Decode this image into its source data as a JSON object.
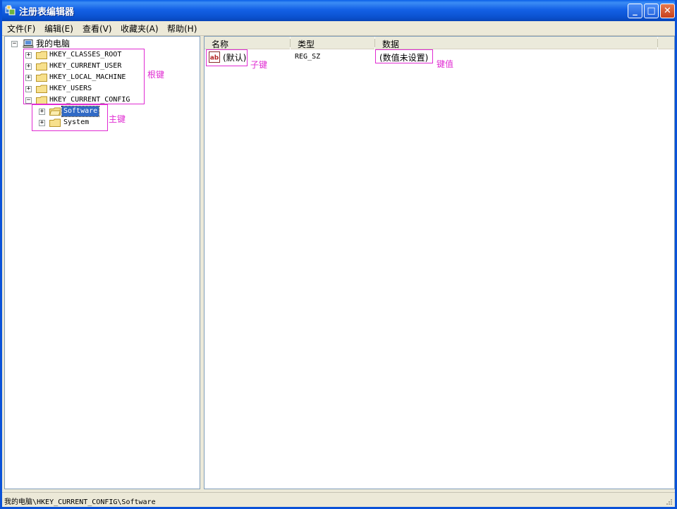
{
  "window": {
    "title": "注册表编辑器",
    "buttons": {
      "minimize": "_",
      "maximize": "□",
      "close": "✕"
    }
  },
  "menu": [
    "文件(F)",
    "编辑(E)",
    "查看(V)",
    "收藏夹(A)",
    "帮助(H)"
  ],
  "tree": {
    "root": "我的电脑",
    "root_keys": [
      "HKEY_CLASSES_ROOT",
      "HKEY_CURRENT_USER",
      "HKEY_LOCAL_MACHINE",
      "HKEY_USERS",
      "HKEY_CURRENT_CONFIG"
    ],
    "children": [
      "Software",
      "System"
    ],
    "selected": "Software"
  },
  "list": {
    "columns": [
      "名称",
      "类型",
      "数据"
    ],
    "rows": [
      {
        "name": "(默认)",
        "type": "REG_SZ",
        "data": "(数值未设置)"
      }
    ]
  },
  "annotations": {
    "root_keys": "根键",
    "main_keys": "主键",
    "sub_key": "子键",
    "key_value": "键值",
    "color": "#E02BD2"
  },
  "status": {
    "path": "我的电脑\\HKEY_CURRENT_CONFIG\\Software"
  },
  "icons": [
    "regedit-icon",
    "computer-icon",
    "folder-icon",
    "string-value-icon"
  ]
}
